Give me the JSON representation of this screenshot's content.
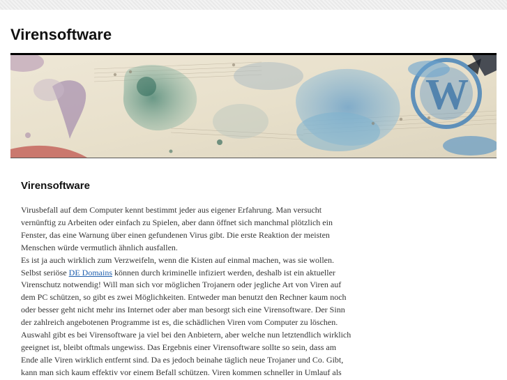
{
  "site": {
    "title": "Virensoftware"
  },
  "banner": {
    "label": "WordPress header image with watercolor ink splashes and sheet music"
  },
  "post": {
    "title": "Virensoftware",
    "paragraph1": "Virusbefall auf dem Computer kennt bestimmt jeder aus eigener Erfahrung. Man versucht vernünftig zu Arbeiten oder einfach zu Spielen, aber dann öffnet sich manchmal plötzlich ein Fenster, das eine Warnung über einen gefundenen Virus gibt. Die erste Reaktion der meisten Menschen würde vermutlich ähnlich ausfallen.",
    "paragraph2_before_link": "Es ist ja auch wirklich zum Verzweifeln, wenn die Kisten auf einmal machen, was sie wollen. Selbst seriöse ",
    "link_text": "DE Domains",
    "paragraph2_after_link": " können durch kriminelle infiziert werden, deshalb ist ein aktueller Virenschutz notwendig! Will man sich vor möglichen Trojanern oder jegliche Art von Viren auf dem PC schützen, so gibt es zwei Möglichkeiten. Entweder man benutzt den Rechner kaum noch oder besser geht nicht mehr ins Internet oder aber man besorgt sich eine Virensoftware. Der Sinn der zahlreich angebotenen Programme ist es, die schädlichen Viren vom Computer zu löschen. Auswahl gibt es bei Virensoftware ja viel bei den Anbietern, aber welche nun letztendlich wirklich geeignet ist, bleibt oftmals ungewiss. Das Ergebnis einer Virensoftware sollte so sein, dass am Ende alle Viren wirklich entfernt sind. Da es jedoch beinahe täglich neue Trojaner und Co. Gibt, kann man sich kaum effektiv vor einem Befall schützen. Viren kommen schneller in Umlauf als man notwendige Software als Abwehr"
  }
}
